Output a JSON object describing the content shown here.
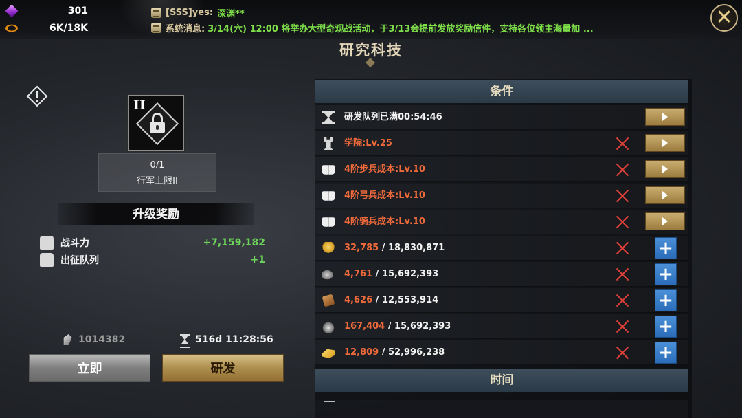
{
  "resources": {
    "gems": "301",
    "gold_march": "6K/18K",
    "gem_icon": "purple-gem-icon",
    "coin_icon": "orange-ring-icon"
  },
  "chat": {
    "name": "[SSS]yes:",
    "message": "深渊**",
    "system_label": "系统消息:",
    "system_message": "3/14(六) 12:00 将举办大型奇观战活动，于3/13会提前发放奖励信件，支持各位领主海量加 ..."
  },
  "title": "研究科技",
  "close_label": "✕",
  "tech": {
    "roman": "II",
    "progress": "0/1",
    "name": "行军上限II"
  },
  "reward": {
    "header": "升级奖励",
    "items": [
      {
        "label": "战斗力",
        "value": "+7,159,182"
      },
      {
        "label": "出征队列",
        "value": "+1"
      }
    ]
  },
  "cost": {
    "stones": "1014382",
    "time": "516d 11:28:56"
  },
  "buttons": {
    "instant": "立即",
    "research": "研发"
  },
  "conditions": {
    "header": "条件",
    "rows": [
      {
        "icon": "hourglass",
        "label": "研发队列已满00:54:46",
        "color": "white",
        "failed": false,
        "action": "go"
      },
      {
        "icon": "tower",
        "label": "学院:Lv.25",
        "color": "red",
        "failed": true,
        "action": "go"
      },
      {
        "icon": "book",
        "label": "4阶步兵成本:Lv.10",
        "color": "red",
        "failed": true,
        "action": "go"
      },
      {
        "icon": "book",
        "label": "4阶弓兵成本:Lv.10",
        "color": "red",
        "failed": true,
        "action": "go"
      },
      {
        "icon": "book",
        "label": "4阶骑兵成本:Lv.10",
        "color": "red",
        "failed": true,
        "action": "go"
      },
      {
        "icon": "wheat",
        "have": "32,785",
        "need": "18,830,871",
        "failed": true,
        "action": "plus"
      },
      {
        "icon": "ore",
        "have": "4,761",
        "need": "15,692,393",
        "failed": true,
        "action": "plus"
      },
      {
        "icon": "wood",
        "have": "4,626",
        "need": "12,553,914",
        "failed": true,
        "action": "plus"
      },
      {
        "icon": "iron",
        "have": "167,404",
        "need": "15,692,393",
        "failed": true,
        "action": "plus"
      },
      {
        "icon": "gold",
        "have": "12,809",
        "need": "52,996,238",
        "failed": true,
        "action": "plus"
      }
    ]
  },
  "time_section": {
    "header": "时间"
  },
  "colors": {
    "accent_gold": "#c9ad70",
    "requirement_red": "#ee6a3b",
    "bonus_green": "#6cd45a",
    "plus_blue": "#2a6cb8"
  }
}
